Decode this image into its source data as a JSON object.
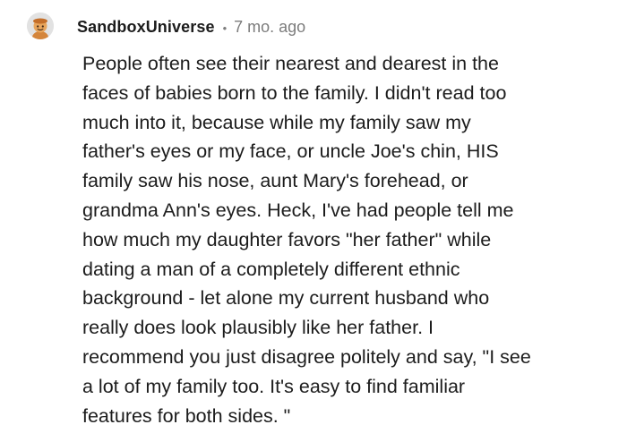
{
  "comment": {
    "author": "SandboxUniverse",
    "separator": "•",
    "timestamp": "7 mo. ago",
    "avatar_icon": "reddit-snoo-avatar-icon",
    "lines": [
      "People often see their nearest and dearest in the",
      "faces of babies born to the family. I didn't read too",
      "much into it, because while my family saw my",
      "father's eyes or my face, or uncle Joe's chin, HIS",
      "family saw his nose, aunt Mary's forehead, or",
      "grandma Ann's eyes. Heck, I've had people tell me",
      "how much my daughter favors \"her father\" while",
      "dating a man of a completely different ethnic",
      "background - let alone my current husband who",
      "really does look plausibly like her father. I",
      "recommend you just disagree politely and say, \"I see",
      "a lot of my family too. It's easy to find familiar",
      "features for both sides. \""
    ]
  },
  "colors": {
    "text": "#1c1c1c",
    "meta": "#7c7c7c",
    "avatar_bg": "#e2e2e2",
    "avatar_figure": "#d4853b"
  }
}
